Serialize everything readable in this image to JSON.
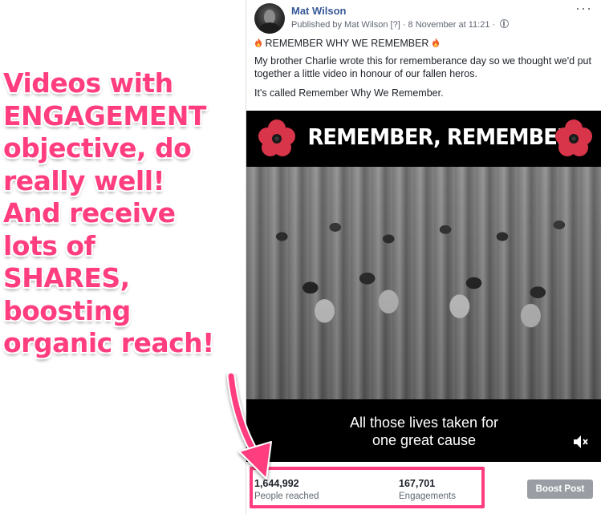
{
  "annotation": {
    "lines": [
      "Videos with",
      "ENGAGEMENT",
      "objective, do",
      "really well!",
      "And receive",
      "lots of",
      "SHARES,",
      "boosting",
      "organic reach!"
    ],
    "color": "#ff3d7f"
  },
  "post": {
    "author": "Mat Wilson",
    "published_by": "Published by Mat Wilson",
    "help_marker": "[?]",
    "separator": "·",
    "date": "8 November at 11:21",
    "separator2": "·",
    "more_glyph": "···",
    "title_line": "REMEMBER WHY WE REMEMBER",
    "body": "My brother Charlie wrote this for rememberance day so we thought we'd put together a little video in honour of our fallen heros.",
    "body2": "It's called Remember Why We Remember.",
    "link_color": "#385898"
  },
  "video": {
    "banner_title": "REMEMBER, REMEMBER",
    "caption_line1": "All those lives taken for",
    "caption_line2": "one great cause"
  },
  "stats": {
    "reached_value": "1,644,992",
    "reached_label": "People reached",
    "engagements_value": "167,701",
    "engagements_label": "Engagements",
    "boost_label": "Boost Post"
  }
}
